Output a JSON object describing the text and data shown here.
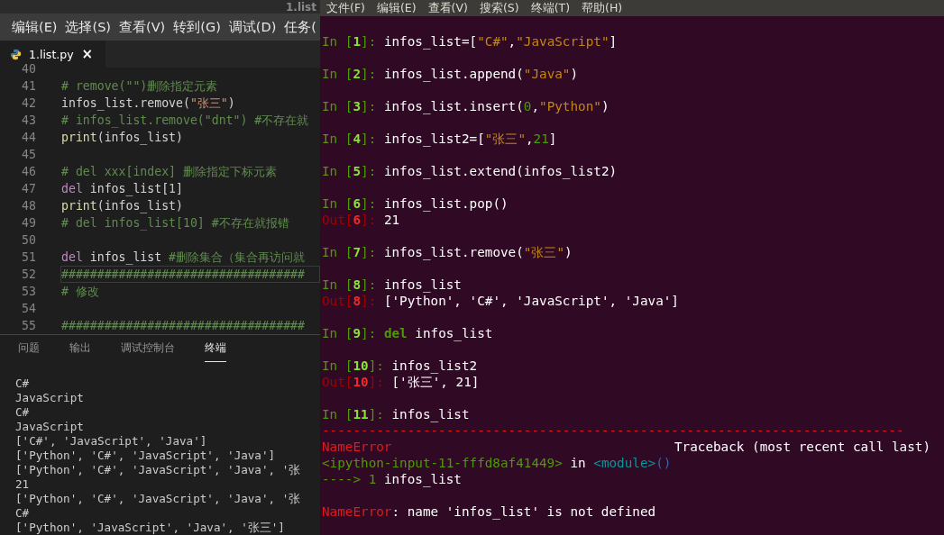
{
  "editor": {
    "title": "1.list",
    "menu": [
      "编辑(E)",
      "选择(S)",
      "查看(V)",
      "转到(G)",
      "调试(D)",
      "任务("
    ],
    "tabs": [
      {
        "label": "1.list.py",
        "selected": true,
        "close": "×"
      }
    ],
    "lines": [
      {
        "number": "40",
        "current": false
      },
      {
        "number": "41",
        "current": false,
        "tokens": [
          {
            "kind": "comment",
            "text": "# remove(\"\")删除指定元素"
          }
        ]
      },
      {
        "number": "42",
        "current": false,
        "tokens": [
          {
            "kind": "plain",
            "text": "infos_list.remove("
          },
          {
            "kind": "string",
            "text": "\"张三\""
          },
          {
            "kind": "plain",
            "text": ")"
          }
        ]
      },
      {
        "number": "43",
        "current": false,
        "tokens": [
          {
            "kind": "comment",
            "text": "# infos_list.remove(\"dnt\") #不存在就"
          }
        ]
      },
      {
        "number": "44",
        "current": false,
        "tokens": [
          {
            "kind": "function",
            "text": "print"
          },
          {
            "kind": "plain",
            "text": "(infos_list)"
          }
        ]
      },
      {
        "number": "45",
        "current": false
      },
      {
        "number": "46",
        "current": false,
        "tokens": [
          {
            "kind": "comment",
            "text": "# del xxx[index] 删除指定下标元素"
          }
        ]
      },
      {
        "number": "47",
        "current": false,
        "tokens": [
          {
            "kind": "keyword",
            "text": "del"
          },
          {
            "kind": "plain",
            "text": " infos_list["
          },
          {
            "kind": "number",
            "text": "1"
          },
          {
            "kind": "plain",
            "text": "]"
          }
        ]
      },
      {
        "number": "48",
        "current": false,
        "tokens": [
          {
            "kind": "function",
            "text": "print"
          },
          {
            "kind": "plain",
            "text": "(infos_list)"
          }
        ]
      },
      {
        "number": "49",
        "current": false,
        "tokens": [
          {
            "kind": "comment",
            "text": "# del infos_list[10] #不存在就报错"
          }
        ]
      },
      {
        "number": "50",
        "current": false
      },
      {
        "number": "51",
        "current": false,
        "tokens": [
          {
            "kind": "keyword",
            "text": "del"
          },
          {
            "kind": "plain",
            "text": " infos_list "
          },
          {
            "kind": "comment",
            "text": "#删除集合（集合再访问就"
          }
        ]
      },
      {
        "number": "52",
        "current": true,
        "tokens": [
          {
            "kind": "comment",
            "text": "##################################"
          }
        ]
      },
      {
        "number": "53",
        "current": false,
        "tokens": [
          {
            "kind": "comment",
            "text": "# 修改"
          }
        ]
      },
      {
        "number": "54",
        "current": false
      },
      {
        "number": "55",
        "current": false,
        "tokens": [
          {
            "kind": "comment",
            "text": "##################################"
          }
        ]
      }
    ],
    "panel_tabs": [
      {
        "label": "问题",
        "selected": false
      },
      {
        "label": "输出",
        "selected": false
      },
      {
        "label": "调试控制台",
        "selected": false
      },
      {
        "label": "终端",
        "selected": true
      }
    ],
    "output": [
      "C#",
      "JavaScript",
      "C#",
      "JavaScript",
      "['C#', 'JavaScript', 'Java']",
      "['Python', 'C#', 'JavaScript', 'Java']",
      "['Python', 'C#', 'JavaScript', 'Java', '张",
      "21",
      "['Python', 'C#', 'JavaScript', 'Java', '张",
      "C#",
      "['Python', 'JavaScript', 'Java', '张三']"
    ]
  },
  "terminal": {
    "menu": [
      "文件(F)",
      "编辑(E)",
      "查看(V)",
      "搜索(S)",
      "终端(T)",
      "帮助(H)"
    ],
    "lines": [
      {
        "kind": "text",
        "tokens": [
          {
            "kind": "in",
            "text": "In ["
          },
          {
            "kind": "in_num",
            "text": "1"
          },
          {
            "kind": "in",
            "text": "]: "
          },
          {
            "kind": "plain",
            "text": "infos_list=["
          },
          {
            "kind": "string",
            "text": "\"C#\""
          },
          {
            "kind": "plain",
            "text": ","
          },
          {
            "kind": "string",
            "text": "\"JavaScript\""
          },
          {
            "kind": "plain",
            "text": "]"
          }
        ]
      },
      {
        "kind": "blank"
      },
      {
        "kind": "text",
        "tokens": [
          {
            "kind": "in",
            "text": "In ["
          },
          {
            "kind": "in_num",
            "text": "2"
          },
          {
            "kind": "in",
            "text": "]: "
          },
          {
            "kind": "plain",
            "text": "infos_list.append("
          },
          {
            "kind": "string",
            "text": "\"Java\""
          },
          {
            "kind": "plain",
            "text": ")"
          }
        ]
      },
      {
        "kind": "blank"
      },
      {
        "kind": "text",
        "tokens": [
          {
            "kind": "in",
            "text": "In ["
          },
          {
            "kind": "in_num",
            "text": "3"
          },
          {
            "kind": "in",
            "text": "]: "
          },
          {
            "kind": "plain",
            "text": "infos_list.insert("
          },
          {
            "kind": "number",
            "text": "0"
          },
          {
            "kind": "plain",
            "text": ","
          },
          {
            "kind": "string",
            "text": "\"Python\""
          },
          {
            "kind": "plain",
            "text": ")"
          }
        ]
      },
      {
        "kind": "blank"
      },
      {
        "kind": "text",
        "tokens": [
          {
            "kind": "in",
            "text": "In ["
          },
          {
            "kind": "in_num",
            "text": "4"
          },
          {
            "kind": "in",
            "text": "]: "
          },
          {
            "kind": "plain",
            "text": "infos_list2=["
          },
          {
            "kind": "string",
            "text": "\"张三\""
          },
          {
            "kind": "plain",
            "text": ","
          },
          {
            "kind": "number",
            "text": "21"
          },
          {
            "kind": "plain",
            "text": "]"
          }
        ]
      },
      {
        "kind": "blank"
      },
      {
        "kind": "text",
        "tokens": [
          {
            "kind": "in",
            "text": "In ["
          },
          {
            "kind": "in_num",
            "text": "5"
          },
          {
            "kind": "in",
            "text": "]: "
          },
          {
            "kind": "plain",
            "text": "infos_list.extend(infos_list2)"
          }
        ]
      },
      {
        "kind": "blank"
      },
      {
        "kind": "text",
        "tokens": [
          {
            "kind": "in",
            "text": "In ["
          },
          {
            "kind": "in_num",
            "text": "6"
          },
          {
            "kind": "in",
            "text": "]: "
          },
          {
            "kind": "plain",
            "text": "infos_list.pop()"
          }
        ]
      },
      {
        "kind": "text",
        "tokens": [
          {
            "kind": "out",
            "text": "Out["
          },
          {
            "kind": "out_num",
            "text": "6"
          },
          {
            "kind": "out",
            "text": "]: "
          },
          {
            "kind": "plain",
            "text": "21"
          }
        ]
      },
      {
        "kind": "blank"
      },
      {
        "kind": "text",
        "tokens": [
          {
            "kind": "in",
            "text": "In ["
          },
          {
            "kind": "in_num",
            "text": "7"
          },
          {
            "kind": "in",
            "text": "]: "
          },
          {
            "kind": "plain",
            "text": "infos_list.remove("
          },
          {
            "kind": "string",
            "text": "\"张三\""
          },
          {
            "kind": "plain",
            "text": ")"
          }
        ]
      },
      {
        "kind": "blank"
      },
      {
        "kind": "text",
        "tokens": [
          {
            "kind": "in",
            "text": "In ["
          },
          {
            "kind": "in_num",
            "text": "8"
          },
          {
            "kind": "in",
            "text": "]: "
          },
          {
            "kind": "plain",
            "text": "infos_list"
          }
        ]
      },
      {
        "kind": "text",
        "tokens": [
          {
            "kind": "out",
            "text": "Out["
          },
          {
            "kind": "out_num",
            "text": "8"
          },
          {
            "kind": "out",
            "text": "]: "
          },
          {
            "kind": "plain",
            "text": "['Python', 'C#', 'JavaScript', 'Java']"
          }
        ]
      },
      {
        "kind": "blank"
      },
      {
        "kind": "text",
        "tokens": [
          {
            "kind": "in",
            "text": "In ["
          },
          {
            "kind": "in_num",
            "text": "9"
          },
          {
            "kind": "in",
            "text": "]: "
          },
          {
            "kind": "keyword",
            "text": "del"
          },
          {
            "kind": "plain",
            "text": " infos_list"
          }
        ]
      },
      {
        "kind": "blank"
      },
      {
        "kind": "text",
        "tokens": [
          {
            "kind": "in",
            "text": "In ["
          },
          {
            "kind": "in_num",
            "text": "10"
          },
          {
            "kind": "in",
            "text": "]: "
          },
          {
            "kind": "plain",
            "text": "infos_list2"
          }
        ]
      },
      {
        "kind": "text",
        "tokens": [
          {
            "kind": "out",
            "text": "Out["
          },
          {
            "kind": "out_num",
            "text": "10"
          },
          {
            "kind": "out",
            "text": "]: "
          },
          {
            "kind": "plain",
            "text": "['张三', 21]"
          }
        ]
      },
      {
        "kind": "blank"
      },
      {
        "kind": "text",
        "tokens": [
          {
            "kind": "in",
            "text": "In ["
          },
          {
            "kind": "in_num",
            "text": "11"
          },
          {
            "kind": "in",
            "text": "]: "
          },
          {
            "kind": "plain",
            "text": "infos_list"
          }
        ]
      },
      {
        "kind": "text",
        "tokens": [
          {
            "kind": "error",
            "text": "---------------------------------------------------------------------------"
          }
        ]
      },
      {
        "kind": "split",
        "tokens": [
          {
            "kind": "error",
            "text": "NameError"
          }
        ],
        "right": "Traceback (most recent call last)"
      },
      {
        "kind": "text",
        "tokens": [
          {
            "kind": "number",
            "text": "<ipython-input-11-fffd8af41449>"
          },
          {
            "kind": "plain",
            "text": " in "
          },
          {
            "kind": "module",
            "text": "<module>"
          },
          {
            "kind": "paren",
            "text": "()"
          }
        ]
      },
      {
        "kind": "text",
        "tokens": [
          {
            "kind": "number",
            "text": "----> 1 "
          },
          {
            "kind": "plain",
            "text": "infos_list"
          }
        ]
      },
      {
        "kind": "blank"
      },
      {
        "kind": "text",
        "tokens": [
          {
            "kind": "error",
            "text": "NameError"
          },
          {
            "kind": "plain",
            "text": ": name 'infos_list' is not defined"
          }
        ]
      }
    ]
  }
}
